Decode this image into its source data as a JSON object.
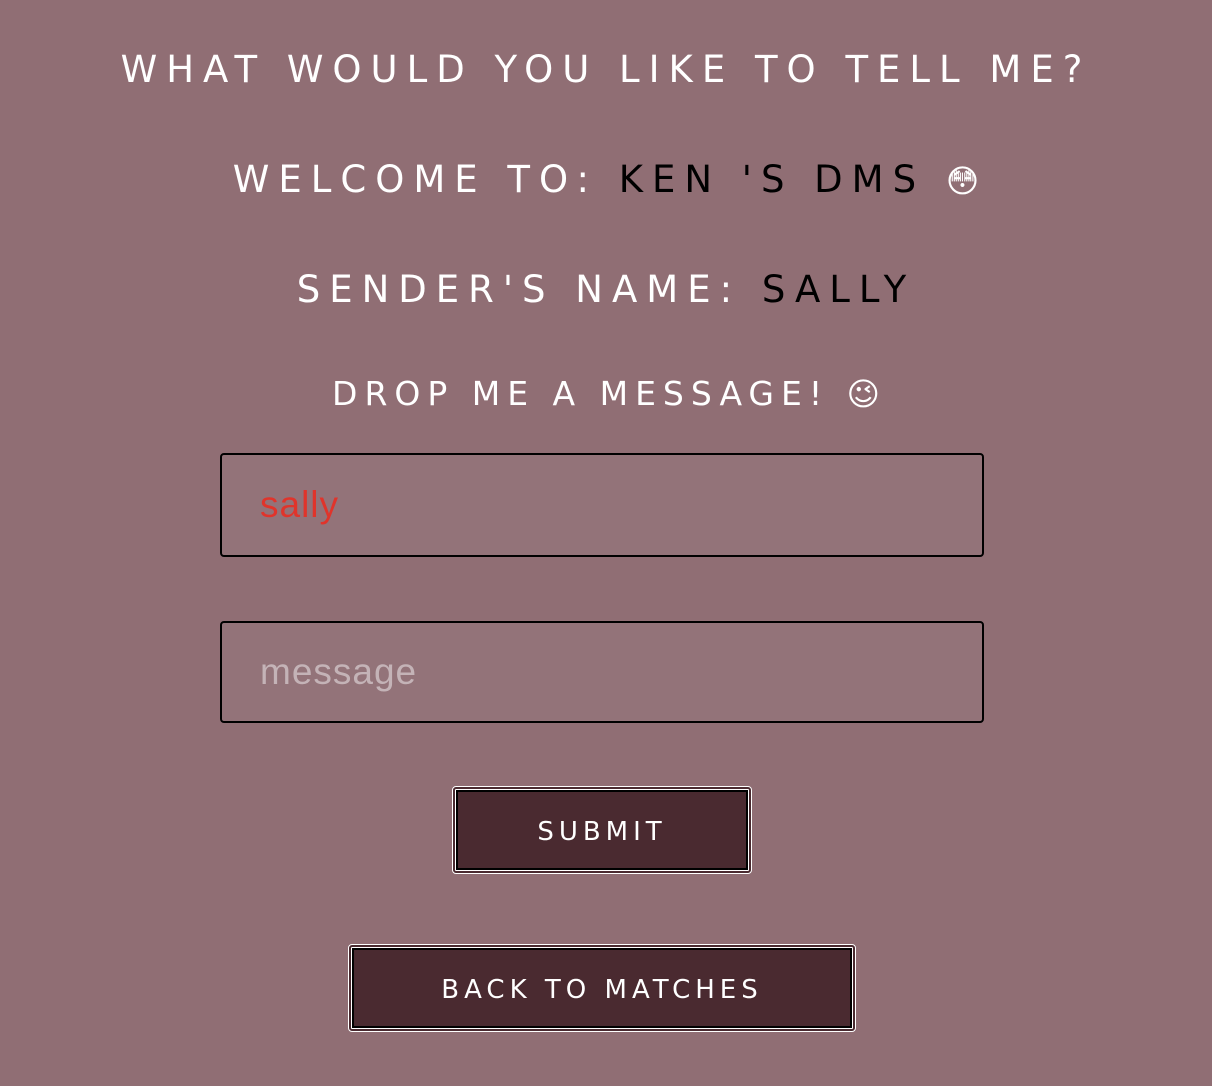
{
  "header": {
    "title": "What would you like to tell me?"
  },
  "welcome": {
    "label": "Welcome to:",
    "recipient": "Ken 's DMs",
    "emoji": "😳"
  },
  "sender": {
    "label": "Sender's name:",
    "name": "sally"
  },
  "prompt": {
    "text": "Drop me a message!",
    "emoji": "😉"
  },
  "form": {
    "name_value": "sally",
    "message_value": "",
    "message_placeholder": "message",
    "submit_label": "Submit"
  },
  "nav": {
    "back_label": "Back to matches"
  },
  "colors": {
    "background": "#906e74",
    "button": "#4a2a30",
    "name_text": "#e0342b"
  }
}
